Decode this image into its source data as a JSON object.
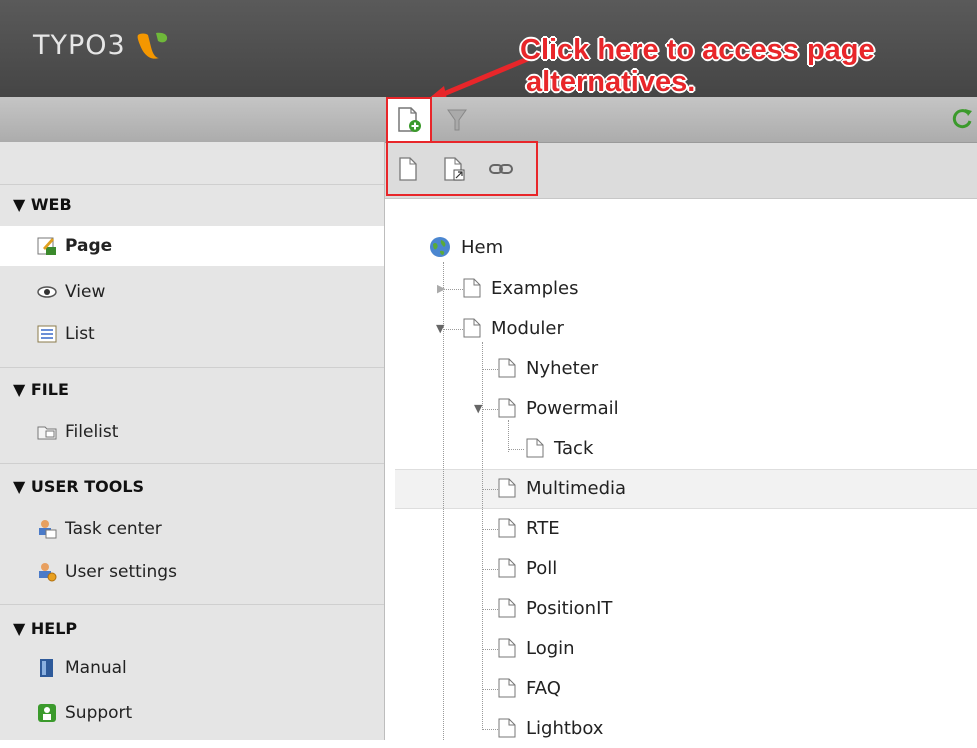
{
  "header": {
    "logo_text": "TYPO3",
    "annotation_line1": "Click here to access page",
    "annotation_line2": "alternatives.",
    "annotation_color": "#e8262a"
  },
  "tree_toolbar": {
    "tab_new_page_icon": "page-new-icon",
    "filter_icon": "filter-icon",
    "refresh_icon": "refresh-icon",
    "buttons": [
      "page-icon",
      "page-shortcut-icon",
      "link-icon"
    ]
  },
  "modules": {
    "sections": [
      {
        "title": "▼ WEB",
        "items": [
          {
            "label": "Page",
            "icon": "page-module-icon",
            "active": true
          },
          {
            "label": "View",
            "icon": "eye-icon"
          },
          {
            "label": "List",
            "icon": "list-icon"
          }
        ]
      },
      {
        "title": "▼ FILE",
        "items": [
          {
            "label": "Filelist",
            "icon": "folder-icon"
          }
        ]
      },
      {
        "title": "▼ USER TOOLS",
        "items": [
          {
            "label": "Task center",
            "icon": "task-center-icon"
          },
          {
            "label": "User settings",
            "icon": "user-settings-icon"
          }
        ]
      },
      {
        "title": "▼ HELP",
        "items": [
          {
            "label": "Manual",
            "icon": "manual-icon"
          },
          {
            "label": "Support",
            "icon": "support-icon"
          }
        ]
      }
    ]
  },
  "tree": {
    "root": "Hem",
    "nodes": [
      {
        "label": "Examples"
      },
      {
        "label": "Moduler"
      },
      {
        "label": "Nyheter"
      },
      {
        "label": "Powermail"
      },
      {
        "label": "Tack"
      },
      {
        "label": "Multimedia",
        "selected": true
      },
      {
        "label": "RTE"
      },
      {
        "label": "Poll"
      },
      {
        "label": "PositionIT"
      },
      {
        "label": "Login"
      },
      {
        "label": "FAQ"
      },
      {
        "label": "Lightbox"
      }
    ]
  }
}
